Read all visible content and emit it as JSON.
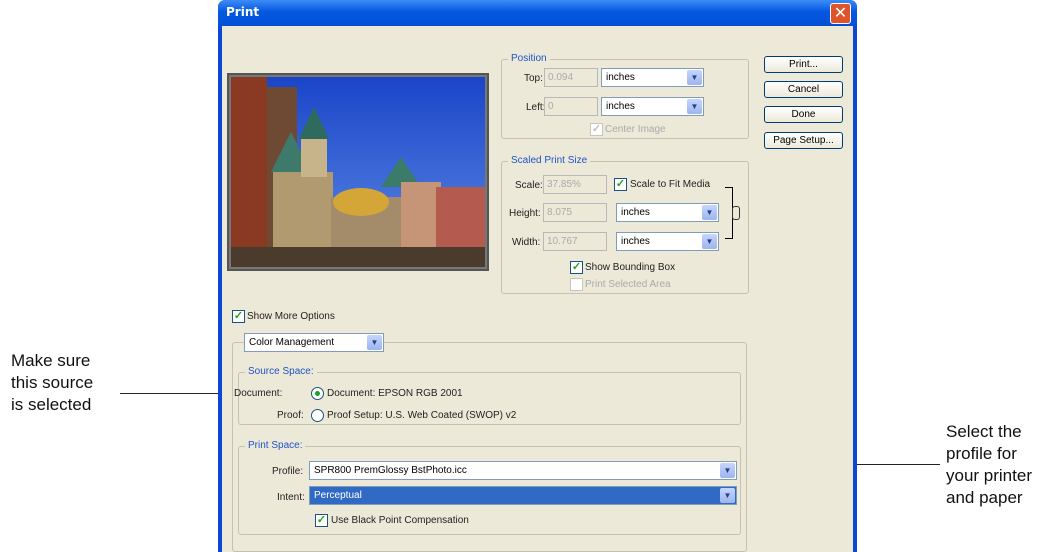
{
  "callouts": {
    "left": [
      "Make sure",
      "this source",
      "is selected"
    ],
    "right": [
      "Select the",
      "profile for",
      "your printer",
      "and paper"
    ]
  },
  "dialog": {
    "title": "Print",
    "close_icon": "close-icon",
    "buttons": {
      "print": "Print...",
      "cancel": "Cancel",
      "done": "Done",
      "page_setup": "Page Setup..."
    },
    "position": {
      "title": "Position",
      "top_label": "Top:",
      "top_value": "0.094",
      "top_unit": "inches",
      "left_label": "Left:",
      "left_value": "0",
      "left_unit": "inches",
      "center_image": "Center Image"
    },
    "scaled": {
      "title": "Scaled Print Size",
      "scale_label": "Scale:",
      "scale_value": "37.85%",
      "scale_to_fit": "Scale to Fit Media",
      "height_label": "Height:",
      "height_value": "8.075",
      "height_unit": "inches",
      "width_label": "Width:",
      "width_value": "10.767",
      "width_unit": "inches",
      "show_bounding_box": "Show Bounding Box",
      "print_selected_area": "Print Selected Area",
      "link_icon": "chain-link-icon"
    },
    "show_more_options": "Show More Options",
    "options_select": "Color Management",
    "source": {
      "title": "Source Space:",
      "document_label": "Document:",
      "document_option": "Document:  EPSON RGB 2001",
      "proof_label": "Proof:",
      "proof_option": "Proof Setup:  U.S. Web Coated (SWOP) v2"
    },
    "print_space": {
      "title": "Print Space:",
      "profile_label": "Profile:",
      "profile_value": "SPR800 PremGlossy BstPhoto.icc",
      "intent_label": "Intent:",
      "intent_value": "Perceptual",
      "black_point": "Use Black Point Compensation"
    }
  },
  "colors": {
    "title_bar": "#0558e0",
    "dialog_bg": "#ece9d8",
    "accent": "#1f52c8",
    "check": "#21a121"
  }
}
